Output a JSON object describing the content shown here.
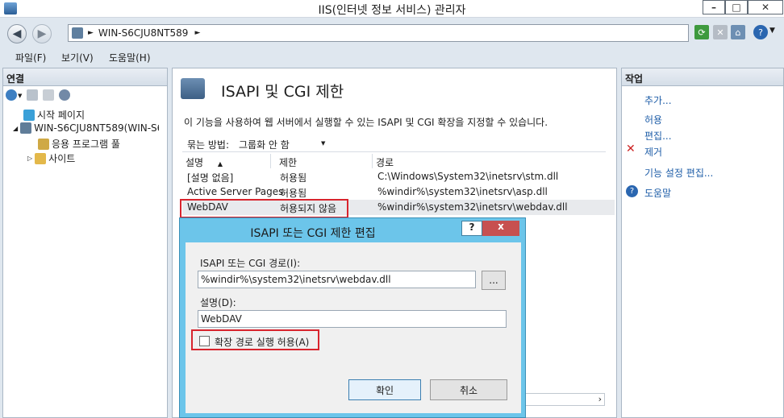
{
  "window": {
    "title": "IIS(인터넷 정보 서비스) 관리자"
  },
  "window_buttons": [
    "–",
    "□",
    "✕"
  ],
  "address": {
    "path": "WIN-S6CJU8NT589",
    "arrow": "►"
  },
  "menu": [
    "파일(F)",
    "보기(V)",
    "도움말(H)"
  ],
  "connections": {
    "title": "연결",
    "items": [
      {
        "label": "시작 페이지"
      },
      {
        "label": "WIN-S6CJU8NT589(WIN-S6C"
      },
      {
        "label": "응용 프로그램 풀"
      },
      {
        "label": "사이트"
      }
    ]
  },
  "feature": {
    "title": "ISAPI 및 CGI 제한",
    "description": "이 기능을 사용하여 웹 서버에서 실행할 수 있는 ISAPI 및 CGI 확장을 지정할 수 있습니다.",
    "group_label": "묶는 방법:",
    "group_value": "그룹화 안 함",
    "columns": [
      "설명",
      "제한",
      "경로"
    ],
    "rows": [
      {
        "desc": "[설명 없음]",
        "restriction": "허용됨",
        "path": "C:\\Windows\\System32\\inetsrv\\stm.dll"
      },
      {
        "desc": "Active Server Pages",
        "restriction": "허용됨",
        "path": "%windir%\\system32\\inetsrv\\asp.dll"
      },
      {
        "desc": "WebDAV",
        "restriction": "허용되지 않음",
        "path": "%windir%\\system32\\inetsrv\\webdav.dll"
      }
    ]
  },
  "actions": {
    "title": "작업",
    "items": [
      "추가...",
      "허용",
      "편집...",
      "제거",
      "기능 설정 편집...",
      "도움말"
    ]
  },
  "dialog": {
    "title": "ISAPI 또는 CGI 제한 편집",
    "help_button": "?",
    "close_button": "x",
    "path_label": "ISAPI 또는 CGI 경로(I):",
    "path_value": "%windir%\\system32\\inetsrv\\webdav.dll",
    "browse_label": "...",
    "desc_label": "설명(D):",
    "desc_value": "WebDAV",
    "checkbox_label": "확장 경로 실행 허용(A)",
    "ok": "확인",
    "cancel": "취소"
  },
  "colors": {
    "highlight_box": "#d8242d",
    "dialog_frame": "#6cc5ea",
    "link": "#1f5ea8"
  }
}
